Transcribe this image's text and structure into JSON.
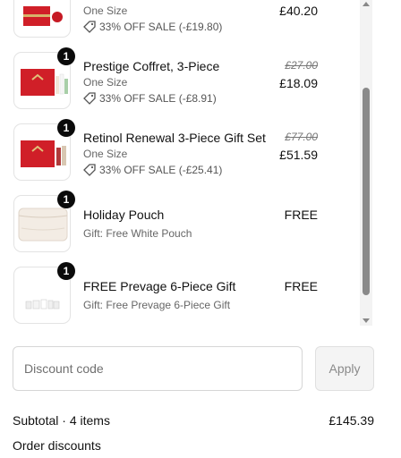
{
  "items": [
    {
      "id": "item0",
      "name": "",
      "variant": "One Size",
      "discount": "33% OFF SALE (-£19.80)",
      "original": "",
      "price": "£40.20",
      "qty": ""
    },
    {
      "id": "item1",
      "name": "Prestige Coffret, 3-Piece",
      "variant": "One Size",
      "discount": "33% OFF SALE (-£8.91)",
      "original": "£27.00",
      "price": "£18.09",
      "qty": "1"
    },
    {
      "id": "item2",
      "name": "Retinol Renewal 3-Piece Gift Set",
      "variant": "One Size",
      "discount": "33% OFF SALE (-£25.41)",
      "original": "£77.00",
      "price": "£51.59",
      "qty": "1"
    },
    {
      "id": "item3",
      "name": "Holiday Pouch",
      "variant": "Gift: Free White Pouch",
      "discount": "",
      "original": "",
      "price": "FREE",
      "qty": "1"
    },
    {
      "id": "item4",
      "name": "FREE Prevage 6-Piece Gift",
      "variant": "Gift: Free Prevage 6-Piece Gift",
      "discount": "",
      "original": "",
      "price": "FREE",
      "qty": "1"
    }
  ],
  "discount": {
    "placeholder": "Discount code",
    "apply_label": "Apply"
  },
  "summary": {
    "subtotal_label": "Subtotal · 4 items",
    "subtotal_value": "£145.39",
    "order_discounts_label": "Order discounts"
  },
  "colors": {
    "gift_box_red": "#d01f28",
    "badge_black": "#0b0b0b",
    "disabled_button_bg": "#f4f4f4"
  }
}
